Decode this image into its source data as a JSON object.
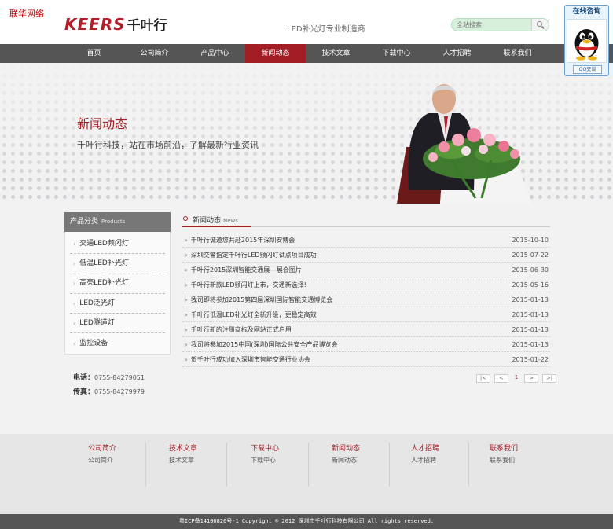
{
  "corner_tag": "联华网络",
  "logo": {
    "en": "KEERS",
    "cn": "千叶行"
  },
  "slogan": "LED补光灯专业制造商",
  "search": {
    "placeholder": "全站搜索"
  },
  "nav": [
    {
      "label": "首页"
    },
    {
      "label": "公司简介"
    },
    {
      "label": "产品中心"
    },
    {
      "label": "新闻动态",
      "active": true
    },
    {
      "label": "技术文章"
    },
    {
      "label": "下载中心"
    },
    {
      "label": "人才招聘"
    },
    {
      "label": "联系我们"
    }
  ],
  "banner": {
    "title": "新闻动态",
    "subtitle": "千叶行科技，站在市场前沿，了解最新行业资讯"
  },
  "sidebar": {
    "title": "产品分类",
    "title_en": "Products",
    "items": [
      {
        "label": "交通LED频闪灯"
      },
      {
        "label": "低温LED补光灯"
      },
      {
        "label": "高亮LED补光灯"
      },
      {
        "label": "LED泛光灯"
      },
      {
        "label": "LED隧道灯"
      },
      {
        "label": "监控设备"
      }
    ]
  },
  "contact": {
    "phone_label": "电话：",
    "phone": "0755-84279051",
    "fax_label": "传真：",
    "fax": "0755-84279979"
  },
  "news": {
    "title": "新闻动态",
    "title_en": "News",
    "rows": [
      {
        "title": "千叶行诚邀您共赴2015年深圳安博会",
        "date": "2015-10-10"
      },
      {
        "title": "深圳交警指定千叶行LED频闪灯试点项目成功",
        "date": "2015-07-22"
      },
      {
        "title": "千叶行2015深圳智能交通展---展会图片",
        "date": "2015-06-30"
      },
      {
        "title": "千叶行新款LED频闪灯上市，交通新选择!",
        "date": "2015-05-16"
      },
      {
        "title": "我司即将参加2015第四届深圳国际智能交通博览会",
        "date": "2015-01-13"
      },
      {
        "title": "千叶行低温LED补光灯全新升级，更稳定高效",
        "date": "2015-01-13"
      },
      {
        "title": "千叶行新的注册商标及网站正式启用",
        "date": "2015-01-13"
      },
      {
        "title": "我司将参加2015中国(深圳)国际公共安全产品博览会",
        "date": "2015-01-13"
      },
      {
        "title": "贺千叶行成功加入深圳市智能交通行业协会",
        "date": "2015-01-22"
      }
    ]
  },
  "pager": {
    "first": "|<",
    "prev": "<",
    "current": "1",
    "next": ">",
    "last": ">|"
  },
  "footer": [
    {
      "heading": "公司简介",
      "link": "公司简介"
    },
    {
      "heading": "技术文章",
      "link": "技术文章"
    },
    {
      "heading": "下载中心",
      "link": "下载中心"
    },
    {
      "heading": "新闻动态",
      "link": "新闻动态"
    },
    {
      "heading": "人才招聘",
      "link": "人才招聘"
    },
    {
      "heading": "联系我们",
      "link": "联系我们"
    }
  ],
  "copyright": "粤ICP备14100826号-1 Copyright © 2012 深圳市千叶行科技有限公司 All rights reserved.",
  "qq": {
    "title": "在线咨询",
    "button": "QQ交谈"
  },
  "colors": {
    "brand_red": "#a21d24",
    "nav_gray": "#555555"
  }
}
